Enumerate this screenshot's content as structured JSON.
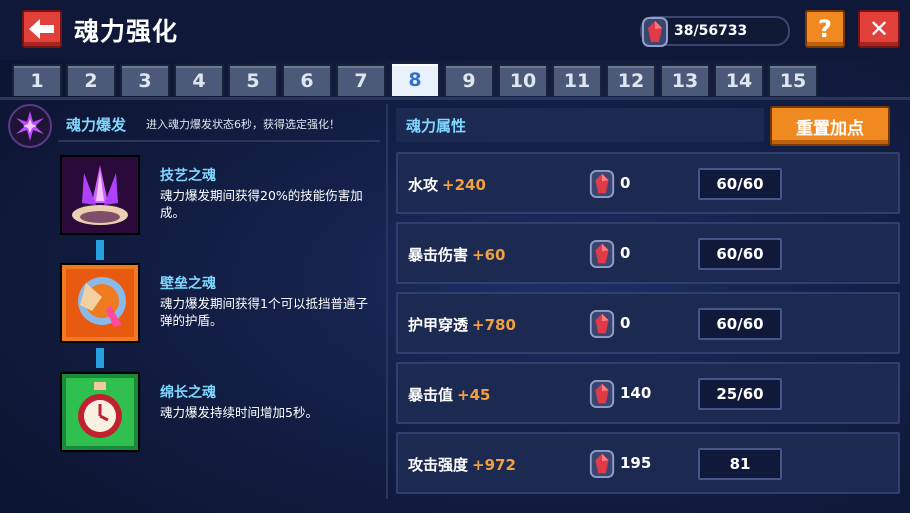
{
  "header": {
    "title": "魂力强化",
    "counter": "38/56733",
    "help_label": "?",
    "close_label": "✕"
  },
  "tabs": [
    "1",
    "2",
    "3",
    "4",
    "5",
    "6",
    "7",
    "8",
    "9",
    "10",
    "11",
    "12",
    "13",
    "14",
    "15"
  ],
  "active_tab": "8",
  "burst": {
    "label": "魂力爆发",
    "description": "进入魂力爆发状态6秒，获得选定强化！"
  },
  "skills": [
    {
      "name": "技艺之魂",
      "description": "魂力爆发期间获得20%的技能伤害加成。",
      "icon": "crystal-icon",
      "color": "#b040ff"
    },
    {
      "name": "壁垒之魂",
      "description": "魂力爆发期间获得1个可以抵挡普通子弹的护盾。",
      "icon": "shield-icon",
      "color": "#f07a20"
    },
    {
      "name": "绵长之魂",
      "description": "魂力爆发持续时间增加5秒。",
      "icon": "stopwatch-icon",
      "color": "#30c050"
    }
  ],
  "attributes": {
    "header": "魂力属性",
    "reset_label": "重置加点",
    "rows": [
      {
        "stat": "水攻",
        "bonus": "+240",
        "cost": "0",
        "level": "60/60"
      },
      {
        "stat": "暴击伤害",
        "bonus": "+60",
        "cost": "0",
        "level": "60/60"
      },
      {
        "stat": "护甲穿透",
        "bonus": "+780",
        "cost": "0",
        "level": "60/60"
      },
      {
        "stat": "暴击值",
        "bonus": "+45",
        "cost": "140",
        "level": "25/60"
      },
      {
        "stat": "攻击强度",
        "bonus": "+972",
        "cost": "195",
        "level": "81"
      }
    ]
  },
  "colors": {
    "accent_orange": "#f08a20",
    "accent_red": "#e2403a",
    "label_blue": "#7fd6ff",
    "bonus_orange": "#f0a040"
  }
}
